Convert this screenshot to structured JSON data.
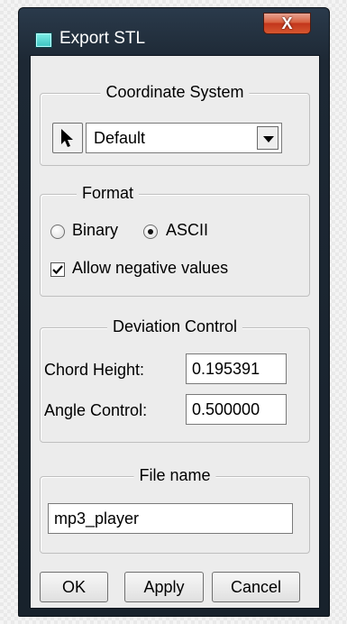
{
  "window": {
    "title": "Export STL",
    "close_label": "X"
  },
  "coordinate_system": {
    "legend": "Coordinate System",
    "selected": "Default"
  },
  "format": {
    "legend": "Format",
    "binary_label": "Binary",
    "ascii_label": "ASCII",
    "selected": "ASCII",
    "allow_negative_label": "Allow negative values",
    "allow_negative_checked": true
  },
  "deviation": {
    "legend": "Deviation Control",
    "chord_height_label": "Chord Height:",
    "chord_height_value": "0.195391",
    "angle_control_label": "Angle Control:",
    "angle_control_value": "0.500000"
  },
  "file": {
    "legend": "File name",
    "value": "mp3_player"
  },
  "buttons": {
    "ok": "OK",
    "apply": "Apply",
    "cancel": "Cancel"
  }
}
